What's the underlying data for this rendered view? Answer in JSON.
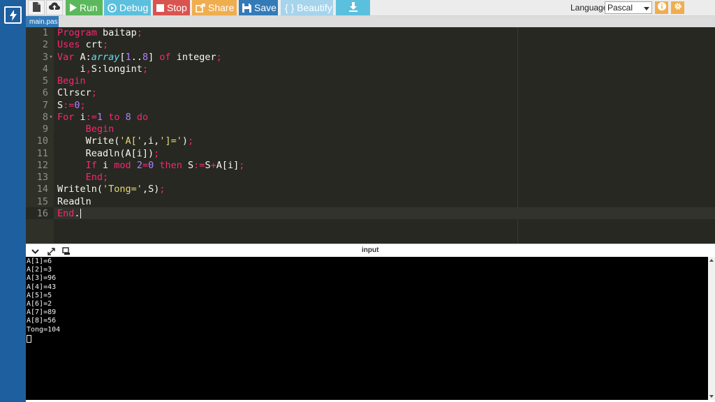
{
  "toolbar": {
    "run_label": "Run",
    "debug_label": "Debug",
    "stop_label": "Stop",
    "share_label": "Share",
    "save_label": "Save",
    "beautify_label": "{ } Beautify",
    "language_label": "Language",
    "language_value": "Pascal"
  },
  "file_tab": "main.pas",
  "editor": {
    "lines": [
      {
        "n": "1",
        "fold": ""
      },
      {
        "n": "2",
        "fold": ""
      },
      {
        "n": "3",
        "fold": "▾"
      },
      {
        "n": "4",
        "fold": ""
      },
      {
        "n": "5",
        "fold": ""
      },
      {
        "n": "6",
        "fold": ""
      },
      {
        "n": "7",
        "fold": ""
      },
      {
        "n": "8",
        "fold": "▾"
      },
      {
        "n": "9",
        "fold": ""
      },
      {
        "n": "10",
        "fold": ""
      },
      {
        "n": "11",
        "fold": ""
      },
      {
        "n": "12",
        "fold": ""
      },
      {
        "n": "13",
        "fold": ""
      },
      {
        "n": "14",
        "fold": ""
      },
      {
        "n": "15",
        "fold": ""
      },
      {
        "n": "16",
        "fold": ""
      }
    ],
    "code": [
      [
        [
          "kw",
          "Program"
        ],
        [
          "pn",
          " baitap"
        ],
        [
          "op",
          ";"
        ]
      ],
      [
        [
          "kw",
          "Uses"
        ],
        [
          "pn",
          " crt"
        ],
        [
          "op",
          ";"
        ]
      ],
      [
        [
          "kw",
          "Var"
        ],
        [
          "pn",
          " A:"
        ],
        [
          "ty",
          "array"
        ],
        [
          "pn",
          "["
        ],
        [
          "num",
          "1"
        ],
        [
          "pn",
          ".."
        ],
        [
          "num",
          "8"
        ],
        [
          "pn",
          "] "
        ],
        [
          "kw",
          "of"
        ],
        [
          "pn",
          " integer"
        ],
        [
          "op",
          ";"
        ]
      ],
      [
        [
          "pn",
          "    i"
        ],
        [
          "op",
          ","
        ],
        [
          "pn",
          "S:longint"
        ],
        [
          "op",
          ";"
        ]
      ],
      [
        [
          "kw",
          "Begin"
        ]
      ],
      [
        [
          "pn",
          "Clrscr"
        ],
        [
          "op",
          ";"
        ]
      ],
      [
        [
          "pn",
          "S"
        ],
        [
          "op",
          ":="
        ],
        [
          "num",
          "0"
        ],
        [
          "op",
          ";"
        ]
      ],
      [
        [
          "kw",
          "For"
        ],
        [
          "pn",
          " i"
        ],
        [
          "op",
          ":="
        ],
        [
          "num",
          "1"
        ],
        [
          "pn",
          " "
        ],
        [
          "kw",
          "to"
        ],
        [
          "pn",
          " "
        ],
        [
          "num",
          "8"
        ],
        [
          "pn",
          " "
        ],
        [
          "kw",
          "do"
        ]
      ],
      [
        [
          "pn",
          "     "
        ],
        [
          "kw",
          "Begin"
        ]
      ],
      [
        [
          "pn",
          "     Write("
        ],
        [
          "str",
          "'A['"
        ],
        [
          "pn",
          ",i,"
        ],
        [
          "str",
          "']='"
        ],
        [
          "pn",
          ")"
        ],
        [
          "op",
          ";"
        ]
      ],
      [
        [
          "pn",
          "     Readln(A[i])"
        ],
        [
          "op",
          ";"
        ]
      ],
      [
        [
          "pn",
          "     "
        ],
        [
          "kw",
          "If"
        ],
        [
          "pn",
          " i "
        ],
        [
          "kw",
          "mod"
        ],
        [
          "pn",
          " "
        ],
        [
          "num",
          "2"
        ],
        [
          "op",
          "="
        ],
        [
          "num",
          "0"
        ],
        [
          "pn",
          " "
        ],
        [
          "kw",
          "then"
        ],
        [
          "pn",
          " S"
        ],
        [
          "op",
          ":="
        ],
        [
          "pn",
          "S"
        ],
        [
          "op",
          "+"
        ],
        [
          "pn",
          "A[i]"
        ],
        [
          "op",
          ";"
        ]
      ],
      [
        [
          "pn",
          "     "
        ],
        [
          "kw",
          "End"
        ],
        [
          "op",
          ";"
        ]
      ],
      [
        [
          "pn",
          "Writeln("
        ],
        [
          "str",
          "'Tong='"
        ],
        [
          "pn",
          ",S)"
        ],
        [
          "op",
          ";"
        ]
      ],
      [
        [
          "pn",
          "Readln"
        ]
      ],
      [
        [
          "kw",
          "End"
        ],
        [
          "pn",
          "."
        ]
      ]
    ]
  },
  "io": {
    "label": "input",
    "output": [
      "A[1]=6",
      "A[2]=3",
      "A[3]=96",
      "A[4]=43",
      "A[5]=5",
      "A[6]=2",
      "A[7]=89",
      "A[8]=56",
      "Tong=104"
    ]
  },
  "colors": {
    "run": "#5cb85c",
    "debug": "#5bc0de",
    "stop": "#d9534f",
    "share": "#f0ad4e",
    "save": "#337ab7",
    "editor_bg": "#272822"
  }
}
